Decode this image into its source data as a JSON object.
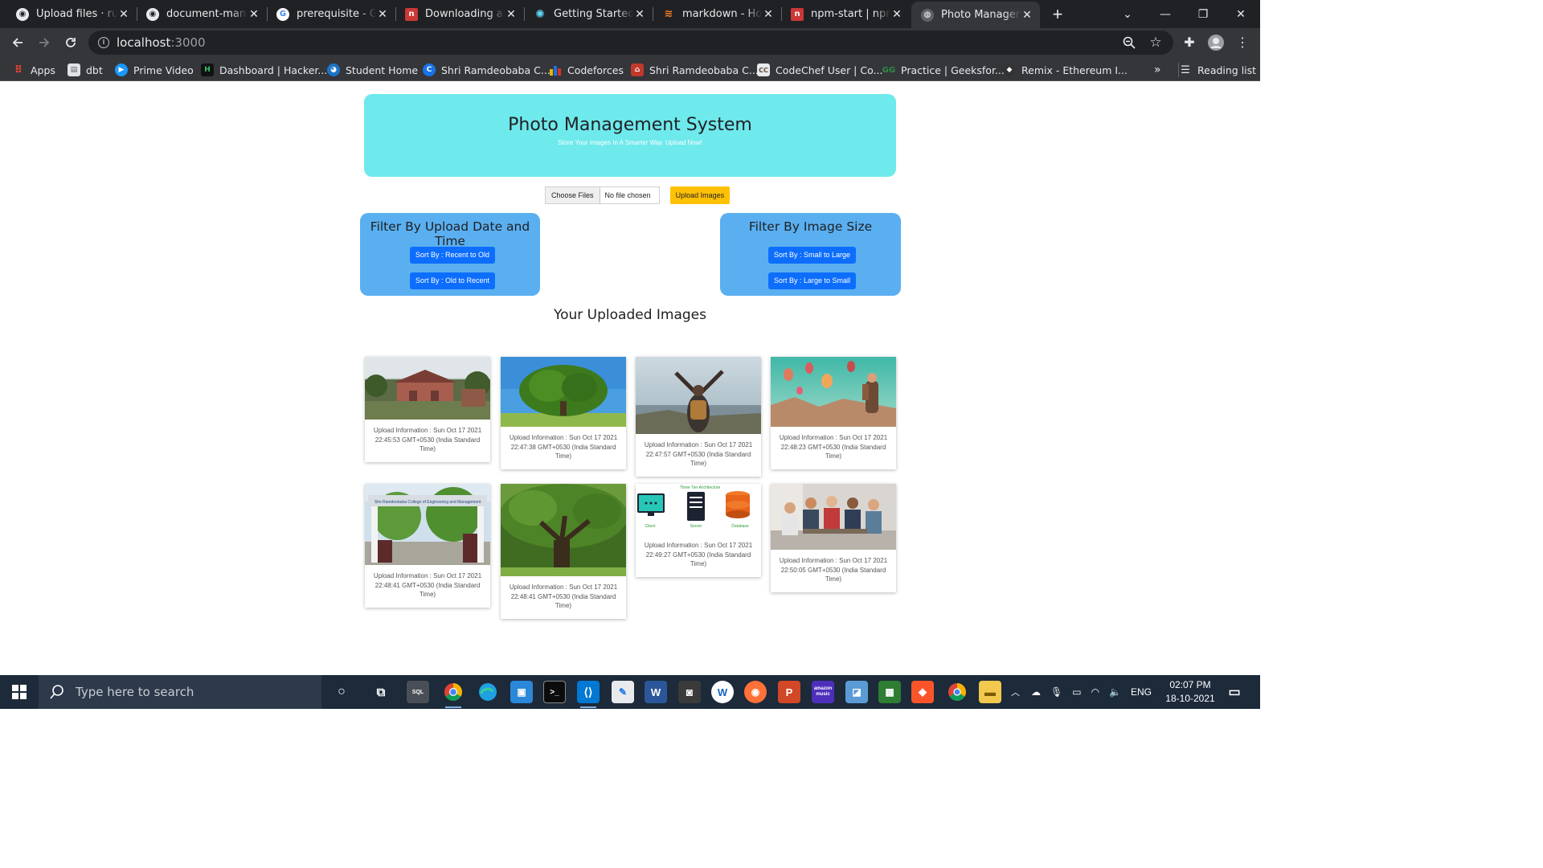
{
  "browser": {
    "tabs": [
      {
        "label": "Upload files · rushi",
        "icon": "github-icon"
      },
      {
        "label": "document-management",
        "icon": "github-icon"
      },
      {
        "label": "prerequisite - Google Search",
        "icon": "google-icon"
      },
      {
        "label": "Downloading and installing",
        "icon": "npm-icon"
      },
      {
        "label": "Getting Started with",
        "icon": "react-icon"
      },
      {
        "label": "markdown - How to",
        "icon": "stackoverflow-icon"
      },
      {
        "label": "npm-start | npm Docs",
        "icon": "npm-icon"
      },
      {
        "label": "Photo Management System",
        "icon": "globe-icon",
        "active": true
      }
    ],
    "url": "localhost",
    "url_port": ":3000",
    "bookmarks": [
      {
        "label": "Apps",
        "icon": "apps-grid-icon",
        "color": "#ea4335"
      },
      {
        "label": "dbt",
        "icon": "document-icon",
        "color": "#9aa0a6"
      },
      {
        "label": "Prime Video",
        "icon": "prime-video-icon",
        "color": "#1a98ff"
      },
      {
        "label": "Dashboard | Hacker...",
        "icon": "hackerrank-icon",
        "color": "#111111"
      },
      {
        "label": "Student Home",
        "icon": "student-icon",
        "color": "#1b74c8"
      },
      {
        "label": "Shri Ramdeobaba C...",
        "icon": "c-icon",
        "color": "#1a73e8"
      },
      {
        "label": "Codeforces",
        "icon": "codeforces-icon",
        "color": "#f0b400"
      },
      {
        "label": "Shri Ramdeobaba C...",
        "icon": "college-icon",
        "color": "#c0392b"
      },
      {
        "label": "CodeChef User | Co...",
        "icon": "codechef-icon",
        "color": "#5b4638"
      },
      {
        "label": "Practice | Geeksfor...",
        "icon": "geeksforgeeks-icon",
        "color": "#2f8d46"
      },
      {
        "label": "Remix - Ethereum I...",
        "icon": "remix-icon",
        "color": "#333333"
      }
    ],
    "bookmarks_overflow": "»",
    "reading_list": "Reading list"
  },
  "page": {
    "hero": {
      "title": "Photo Management System",
      "subtitle": "Store Your Images In A Smarter Way. Upload Now!"
    },
    "upload": {
      "choose_label": "Choose Files",
      "file_status": "No file chosen",
      "upload_label": "Upload Images"
    },
    "filter_date": {
      "title": "Filter By Upload Date and Time",
      "btn1": "Sort By : Recent to Old",
      "btn2": "Sort By : Old to Recent"
    },
    "filter_size": {
      "title": "Filter By Image Size",
      "btn1": "Sort By : Small to Large",
      "btn2": "Sort By : Large to Small"
    },
    "gallery_title": "Your Uploaded Images",
    "images": [
      {
        "caption": "Upload Information : Sun Oct 17 2021 22:45:53 GMT+0530 (India Standard Time)",
        "subject": "campus-building"
      },
      {
        "caption": "Upload Information : Sun Oct 17 2021 22:47:38 GMT+0530 (India Standard Time)",
        "subject": "lone-tree"
      },
      {
        "caption": "Upload Information : Sun Oct 17 2021 22:47:57 GMT+0530 (India Standard Time)",
        "subject": "hiker-on-cliff"
      },
      {
        "caption": "Upload Information : Sun Oct 17 2021 22:48:23 GMT+0530 (India Standard Time)",
        "subject": "hot-air-balloons"
      },
      {
        "caption": "Upload Information : Sun Oct 17 2021 22:48:41 GMT+0530 (India Standard Time)",
        "subject": "college-gate",
        "sign": "Shri Ramdeobaba College of Engineering and Management"
      },
      {
        "caption": "Upload Information : Sun Oct 17 2021 22:48:41 GMT+0530 (India Standard Time)",
        "subject": "large-tree"
      },
      {
        "caption": "Upload Information : Sun Oct 17 2021 22:49:27 GMT+0530 (India Standard Time)",
        "subject": "three-tier-diagram",
        "diagram_title": "Three Tier Architecture",
        "diagram_labels": [
          "Client",
          "Server",
          "Database"
        ]
      },
      {
        "caption": "Upload Information : Sun Oct 17 2021 22:50:05 GMT+0530 (India Standard Time)",
        "subject": "team-meeting"
      }
    ]
  },
  "taskbar": {
    "search_placeholder": "Type here to search",
    "language": "ENG",
    "time": "02:07 PM",
    "date": "18-10-2021"
  },
  "colors": {
    "hero_bg": "#6ee9ec",
    "filter_bg": "#5aaff0",
    "sort_button": "#0d6efd",
    "upload_button": "#ffc107"
  }
}
